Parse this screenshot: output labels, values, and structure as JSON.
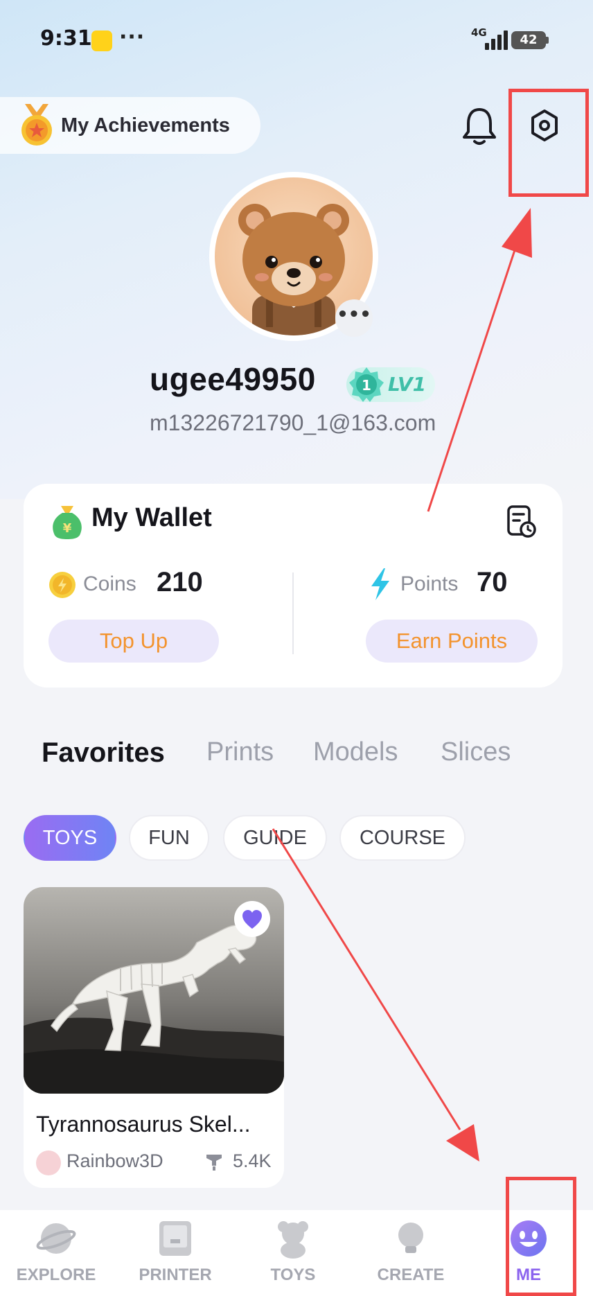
{
  "status_bar": {
    "time": "9:31",
    "dots": "···",
    "network": "4G",
    "battery": "42"
  },
  "header": {
    "achievements_label": "My Achievements"
  },
  "profile": {
    "username": "ugee49950",
    "level": "LV1",
    "level_number": "1",
    "email": "m13226721790_1@163.com",
    "more": "•••"
  },
  "wallet": {
    "title": "My Wallet",
    "coins_label": "Coins",
    "coins_value": "210",
    "points_label": "Points",
    "points_value": "70",
    "topup_label": "Top Up",
    "earn_label": "Earn Points"
  },
  "tabs": [
    "Favorites",
    "Prints",
    "Models",
    "Slices"
  ],
  "chips": [
    "TOYS",
    "FUN",
    "GUIDE",
    "COURSE"
  ],
  "card": {
    "title": "Tyrannosaurus Skel...",
    "author": "Rainbow3D",
    "downloads": "5.4K"
  },
  "nav": [
    "EXPLORE",
    "PRINTER",
    "TOYS",
    "CREATE",
    "ME"
  ],
  "colors": {
    "accent": "#8b63ee",
    "orange": "#f3932d",
    "annotation_red": "#f04848"
  }
}
